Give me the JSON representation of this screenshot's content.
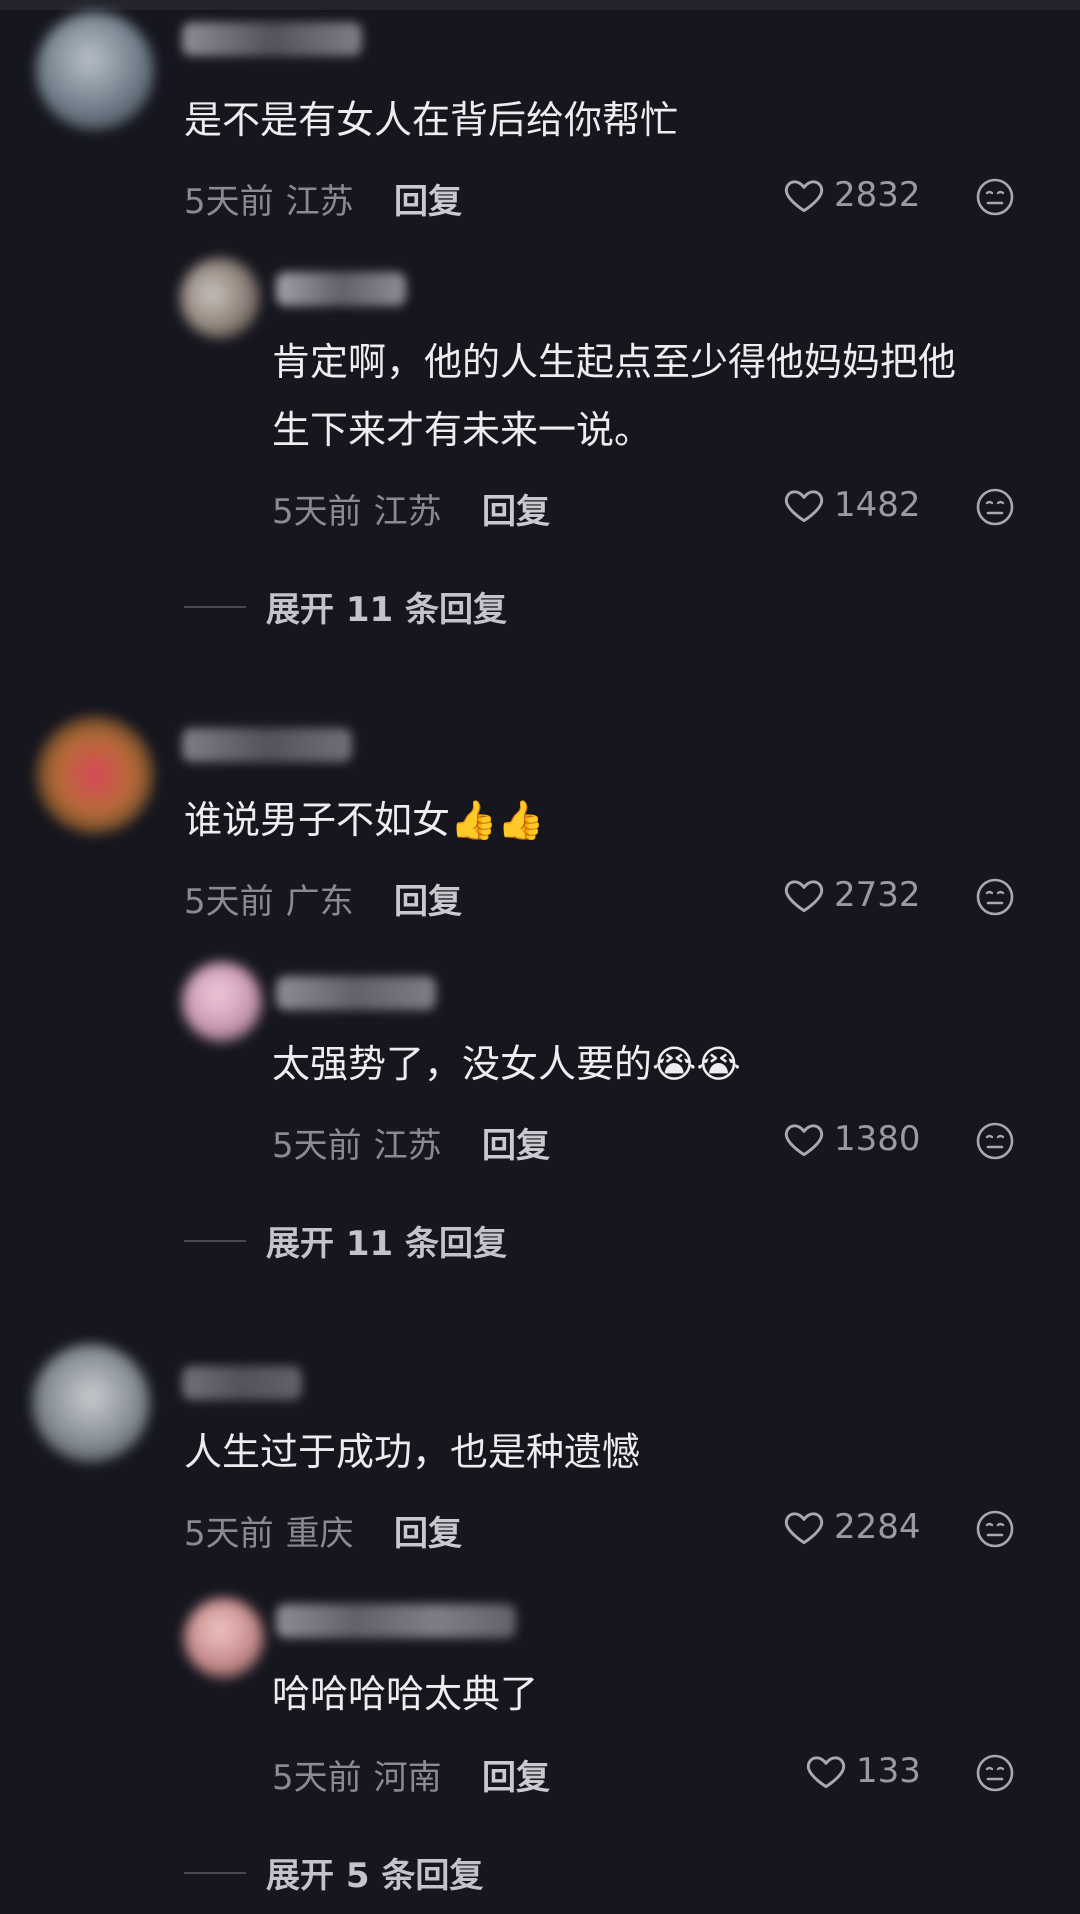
{
  "threads": [
    {
      "comment": {
        "text": "是不是有女人在背后给你帮忙",
        "time": "5天前",
        "location": "江苏",
        "reply": "回复",
        "likes": "2832"
      },
      "reply_comment": {
        "text_line1": "肯定啊，他的人生起点至少得他妈妈把他",
        "text_line2": "生下来才有未来一说。",
        "time": "5天前",
        "location": "江苏",
        "reply": "回复",
        "likes": "1482"
      },
      "expand_label": "展开 11 条回复"
    },
    {
      "comment": {
        "text": "谁说男子不如女",
        "emoji": "👍👍",
        "time": "5天前",
        "location": "广东",
        "reply": "回复",
        "likes": "2732"
      },
      "reply_comment": {
        "text": "太强势了，没女人要的",
        "emoji": "😭😭",
        "time": "5天前",
        "location": "江苏",
        "reply": "回复",
        "likes": "1380"
      },
      "expand_label": "展开 11 条回复"
    },
    {
      "comment": {
        "text": "人生过于成功，也是种遗憾",
        "time": "5天前",
        "location": "重庆",
        "reply": "回复",
        "likes": "2284"
      },
      "reply_comment": {
        "text": "哈哈哈哈太典了",
        "time": "5天前",
        "location": "河南",
        "reply": "回复",
        "likes": "133"
      },
      "expand_label": "展开 5 条回复"
    }
  ],
  "icons": {
    "like": "heart-outline-icon",
    "reaction": "neutral-face-icon"
  },
  "colors": {
    "background": "#16161e",
    "text_primary": "#ededf0",
    "text_secondary": "#8a8a92"
  }
}
